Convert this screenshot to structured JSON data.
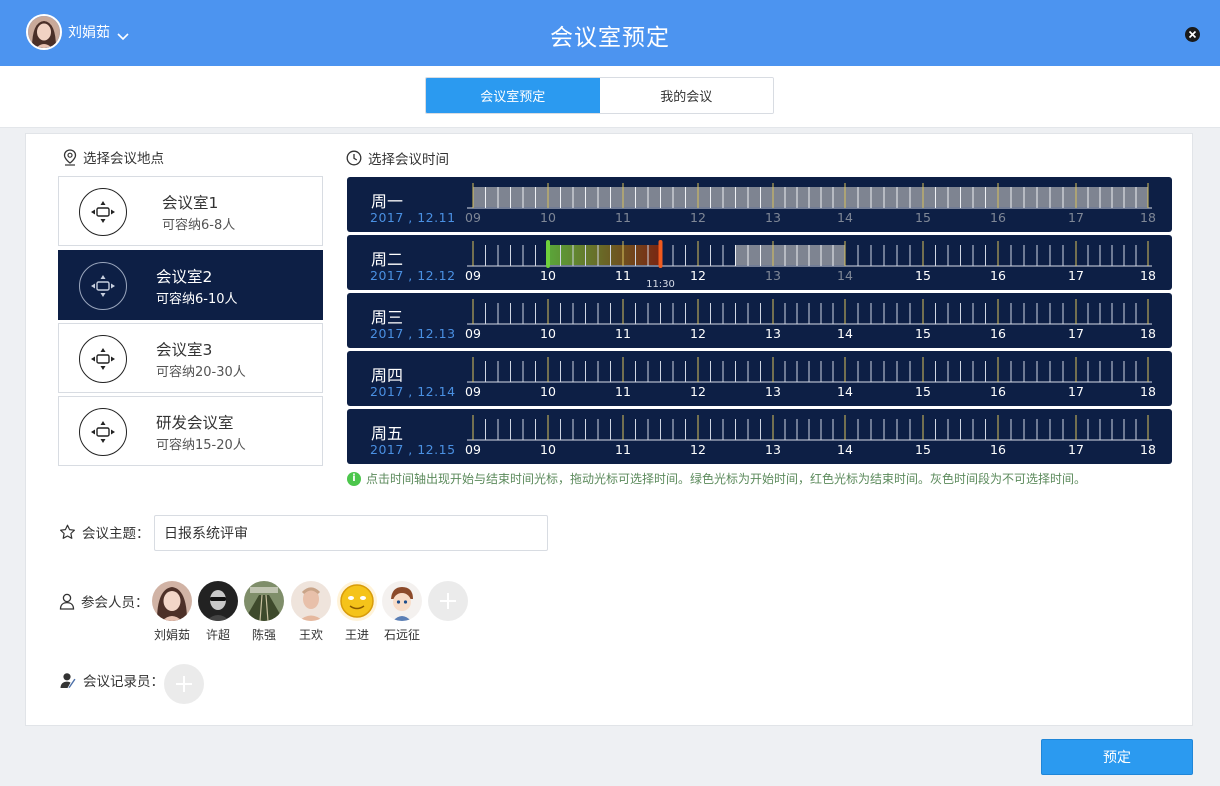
{
  "header": {
    "user_name": "刘娟茹",
    "title": "会议室预定"
  },
  "tabs": [
    {
      "label": "会议室预定",
      "active": true
    },
    {
      "label": "我的会议",
      "active": false
    }
  ],
  "location": {
    "title": "选择会议地点",
    "rooms": [
      {
        "name": "会议室1",
        "capacity": "可容纳6-8人",
        "selected": false
      },
      {
        "name": "会议室2",
        "capacity": "可容纳6-10人",
        "selected": true
      },
      {
        "name": "会议室3",
        "capacity": "可容纳20-30人",
        "selected": false
      },
      {
        "name": "研发会议室",
        "capacity": "可容纳15-20人",
        "selected": false
      }
    ]
  },
  "time": {
    "title": "选择会议时间",
    "hours": [
      "09",
      "10",
      "11",
      "12",
      "13",
      "14",
      "15",
      "16",
      "17",
      "18"
    ],
    "days": [
      {
        "name": "周一",
        "date": "2017 , 12.11",
        "unavailable": [
          [
            9,
            18
          ]
        ]
      },
      {
        "name": "周二",
        "date": "2017 , 12.12",
        "unavailable": [
          [
            12.5,
            14
          ]
        ],
        "selected": [
          10,
          11.5
        ],
        "end_label": "11:30"
      },
      {
        "name": "周三",
        "date": "2017 , 12.13",
        "unavailable": []
      },
      {
        "name": "周四",
        "date": "2017 , 12.14",
        "unavailable": []
      },
      {
        "name": "周五",
        "date": "2017 , 12.15",
        "unavailable": []
      }
    ],
    "note": "点击时间轴出现开始与结束时间光标，拖动光标可选择时间。绿色光标为开始时间，红色光标为结束时间。灰色时间段为不可选择时间。"
  },
  "form": {
    "topic_label": "会议主题：",
    "topic_value": "日报系统评审",
    "attendees_label": "参会人员：",
    "attendees": [
      "刘娟茹",
      "许超",
      "陈强",
      "王欢",
      "王进",
      "石远征"
    ],
    "recorder_label": "会议记录员："
  },
  "submit_label": "预定",
  "colors": {
    "header": "#4c94f0",
    "accent": "#2b9af0",
    "timeline_bg": "#0d1f45",
    "start_cursor": "#6fd13c",
    "end_cursor": "#f05a1e"
  }
}
